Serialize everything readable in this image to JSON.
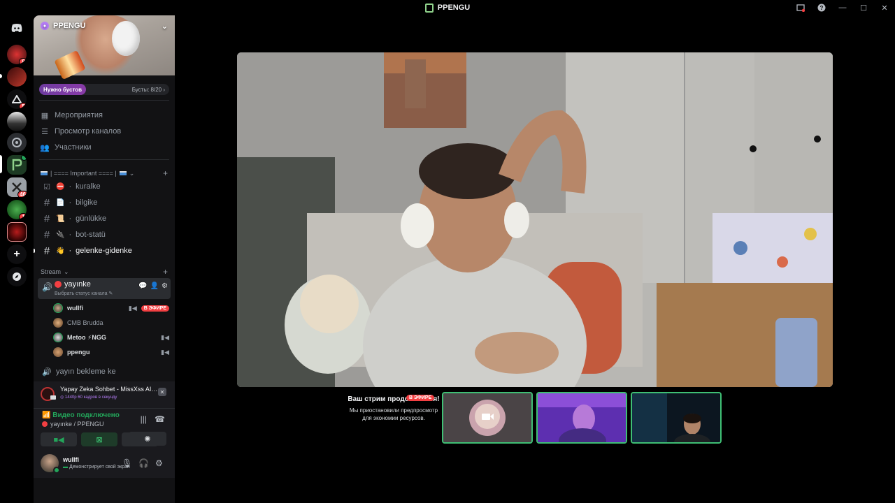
{
  "window": {
    "title": "PPENGU"
  },
  "rail": {
    "servers": [
      {
        "name": "server-1",
        "badge": "8"
      },
      {
        "name": "server-2",
        "badge": ""
      },
      {
        "name": "server-3",
        "badge": "5"
      },
      {
        "name": "server-4",
        "badge": ""
      },
      {
        "name": "server-5",
        "badge": ""
      },
      {
        "name": "server-ppengu",
        "badge": ""
      },
      {
        "name": "server-7",
        "badge": "46"
      },
      {
        "name": "server-8",
        "badge": "1"
      },
      {
        "name": "server-9",
        "badge": ""
      }
    ]
  },
  "server": {
    "name": "PPENGU",
    "boost_need": "Нужно бустов",
    "boost_count": "Бусты: 8/20",
    "nav": [
      "Мероприятия",
      "Просмотр каналов",
      "Участники"
    ],
    "category_important": "| ==== Important ==== |",
    "channels": [
      {
        "name": "kuralke",
        "emoji": "⛔"
      },
      {
        "name": "bilgike",
        "emoji": "📄"
      },
      {
        "name": "günlükke",
        "emoji": "📜"
      },
      {
        "name": "bot-statü",
        "emoji": "🔌"
      },
      {
        "name": "gelenke-gidenke",
        "emoji": "👋"
      }
    ],
    "category_stream": "Stream",
    "voice_channel": {
      "name": "yayınke",
      "status": "Выбрать статус канала"
    },
    "voice_users": [
      {
        "name": "wullfi",
        "live": "В ЭФИРЕ"
      },
      {
        "name": "CMB Brudda"
      },
      {
        "name": "Metoo ⚡NGG"
      },
      {
        "name": "ppengu"
      }
    ],
    "voice_channel_2": "yayın bekleme ke"
  },
  "activity": {
    "title": "Yapay Zeka Sohbet - MissXss AI Bot Syste...",
    "sub": "1440p 60 кадров в секунду"
  },
  "connection": {
    "status": "Видео подключено",
    "where": "yayınke / PPENGU"
  },
  "user": {
    "name": "wullfi",
    "status": "Демонстрирует свой экран"
  },
  "stage": {
    "notice_title": "Ваш стрим продолжается!",
    "notice_live": "В ЭФИРЕ",
    "notice_body": "Мы приостановили предпросмотр для экономии ресурсов."
  },
  "colors": {
    "accent_green": "#23a55a",
    "live_red": "#f23f42",
    "boost_purple": "#8a3ba8"
  }
}
